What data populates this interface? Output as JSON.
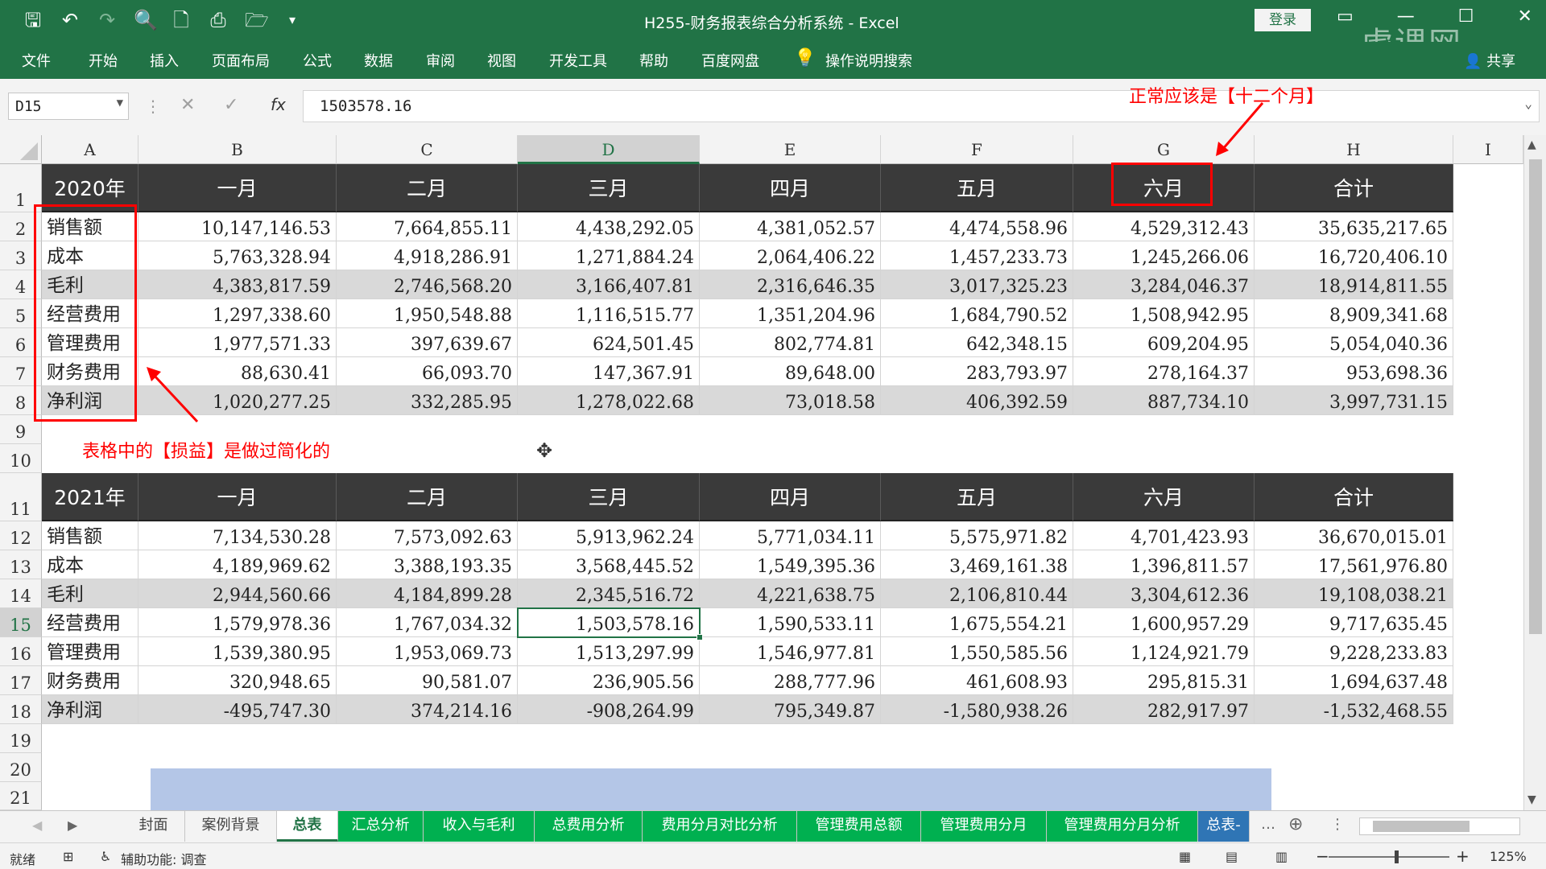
{
  "window": {
    "title": "H255-财务报表综合分析系统 - Excel",
    "login": "登录",
    "share": "共享",
    "watermark": "虎课网"
  },
  "qat_icons": [
    "save-icon",
    "undo-icon",
    "redo-icon",
    "print-preview-icon",
    "new-file-icon",
    "printer-icon",
    "open-folder-icon",
    "customize-qat-icon"
  ],
  "ribbon_tabs": [
    "文件",
    "开始",
    "插入",
    "页面布局",
    "公式",
    "数据",
    "审阅",
    "视图",
    "开发工具",
    "帮助",
    "百度网盘",
    "操作说明搜索"
  ],
  "formula_bar": {
    "name_box": "D15",
    "formula": "1503578.16",
    "fx": "fx"
  },
  "columns": [
    "A",
    "B",
    "C",
    "D",
    "E",
    "F",
    "G",
    "H",
    "I"
  ],
  "rows": [
    "1",
    "2",
    "3",
    "4",
    "5",
    "6",
    "7",
    "8",
    "9",
    "10",
    "11",
    "12",
    "13",
    "14",
    "15",
    "16",
    "17",
    "18",
    "19",
    "20",
    "21"
  ],
  "table_2020": {
    "year": "2020年",
    "headers": [
      "一月",
      "二月",
      "三月",
      "四月",
      "五月",
      "六月",
      "合计"
    ],
    "rows": [
      {
        "label": "销售额",
        "values": [
          "10,147,146.53",
          "7,664,855.11",
          "4,438,292.05",
          "4,381,052.57",
          "4,474,558.96",
          "4,529,312.43",
          "35,635,217.65"
        ]
      },
      {
        "label": "成本",
        "values": [
          "5,763,328.94",
          "4,918,286.91",
          "1,271,884.24",
          "2,064,406.22",
          "1,457,233.73",
          "1,245,266.06",
          "16,720,406.10"
        ]
      },
      {
        "label": "毛利",
        "values": [
          "4,383,817.59",
          "2,746,568.20",
          "3,166,407.81",
          "2,316,646.35",
          "3,017,325.23",
          "3,284,046.37",
          "18,914,811.55"
        ]
      },
      {
        "label": "经营费用",
        "values": [
          "1,297,338.60",
          "1,950,548.88",
          "1,116,515.77",
          "1,351,204.96",
          "1,684,790.52",
          "1,508,942.95",
          "8,909,341.68"
        ]
      },
      {
        "label": "管理费用",
        "values": [
          "1,977,571.33",
          "397,639.67",
          "624,501.45",
          "802,774.81",
          "642,348.15",
          "609,204.95",
          "5,054,040.36"
        ]
      },
      {
        "label": "财务费用",
        "values": [
          "88,630.41",
          "66,093.70",
          "147,367.91",
          "89,648.00",
          "283,793.97",
          "278,164.37",
          "953,698.36"
        ]
      },
      {
        "label": "净利润",
        "values": [
          "1,020,277.25",
          "332,285.95",
          "1,278,022.68",
          "73,018.58",
          "406,392.59",
          "887,734.10",
          "3,997,731.15"
        ]
      }
    ]
  },
  "table_2021": {
    "year": "2021年",
    "headers": [
      "一月",
      "二月",
      "三月",
      "四月",
      "五月",
      "六月",
      "合计"
    ],
    "rows": [
      {
        "label": "销售额",
        "values": [
          "7,134,530.28",
          "7,573,092.63",
          "5,913,962.24",
          "5,771,034.11",
          "5,575,971.82",
          "4,701,423.93",
          "36,670,015.01"
        ]
      },
      {
        "label": "成本",
        "values": [
          "4,189,969.62",
          "3,388,193.35",
          "3,568,445.52",
          "1,549,395.36",
          "3,469,161.38",
          "1,396,811.57",
          "17,561,976.80"
        ]
      },
      {
        "label": "毛利",
        "values": [
          "2,944,560.66",
          "4,184,899.28",
          "2,345,516.72",
          "4,221,638.75",
          "2,106,810.44",
          "3,304,612.36",
          "19,108,038.21"
        ]
      },
      {
        "label": "经营费用",
        "values": [
          "1,579,978.36",
          "1,767,034.32",
          "1,503,578.16",
          "1,590,533.11",
          "1,675,554.21",
          "1,600,957.29",
          "9,717,635.45"
        ]
      },
      {
        "label": "管理费用",
        "values": [
          "1,539,380.95",
          "1,953,069.73",
          "1,513,297.99",
          "1,546,977.81",
          "1,550,585.56",
          "1,124,921.79",
          "9,228,233.83"
        ]
      },
      {
        "label": "财务费用",
        "values": [
          "320,948.65",
          "90,581.07",
          "236,905.56",
          "288,777.96",
          "461,608.93",
          "295,815.31",
          "1,694,637.48"
        ]
      },
      {
        "label": "净利润",
        "values": [
          "-495,747.30",
          "374,214.16",
          "-908,264.99",
          "795,349.87",
          "-1,580,938.26",
          "282,917.97",
          "-1,532,468.55"
        ]
      }
    ]
  },
  "annotations": {
    "top_note": "正常应该是【十二个月】",
    "left_note": "表格中的【损益】是做过简化的",
    "color": "#ff0000"
  },
  "sheet_tabs": [
    {
      "label": "封面",
      "style": "plain"
    },
    {
      "label": "案例背景",
      "style": "plain"
    },
    {
      "label": "总表",
      "style": "active"
    },
    {
      "label": "汇总分析",
      "style": "green"
    },
    {
      "label": "收入与毛利",
      "style": "green"
    },
    {
      "label": "总费用分析",
      "style": "green"
    },
    {
      "label": "费用分月对比分析",
      "style": "green"
    },
    {
      "label": "管理费用总额",
      "style": "green"
    },
    {
      "label": "管理费用分月",
      "style": "green"
    },
    {
      "label": "管理费用分月分析",
      "style": "green"
    },
    {
      "label": "总表-",
      "style": "blue"
    }
  ],
  "status_bar": {
    "ready": "就绪",
    "accessibility": "辅助功能: 调查",
    "zoom": "125%",
    "zoom_minus": "−",
    "zoom_plus": "+"
  },
  "colors": {
    "excel_green": "#217346",
    "table_header": "#3a3a3a",
    "row_highlight": "#d9d9d9",
    "tab_green": "#00b050",
    "tab_blue": "#2f75b5",
    "selection_fill": "#b4c6e7"
  }
}
